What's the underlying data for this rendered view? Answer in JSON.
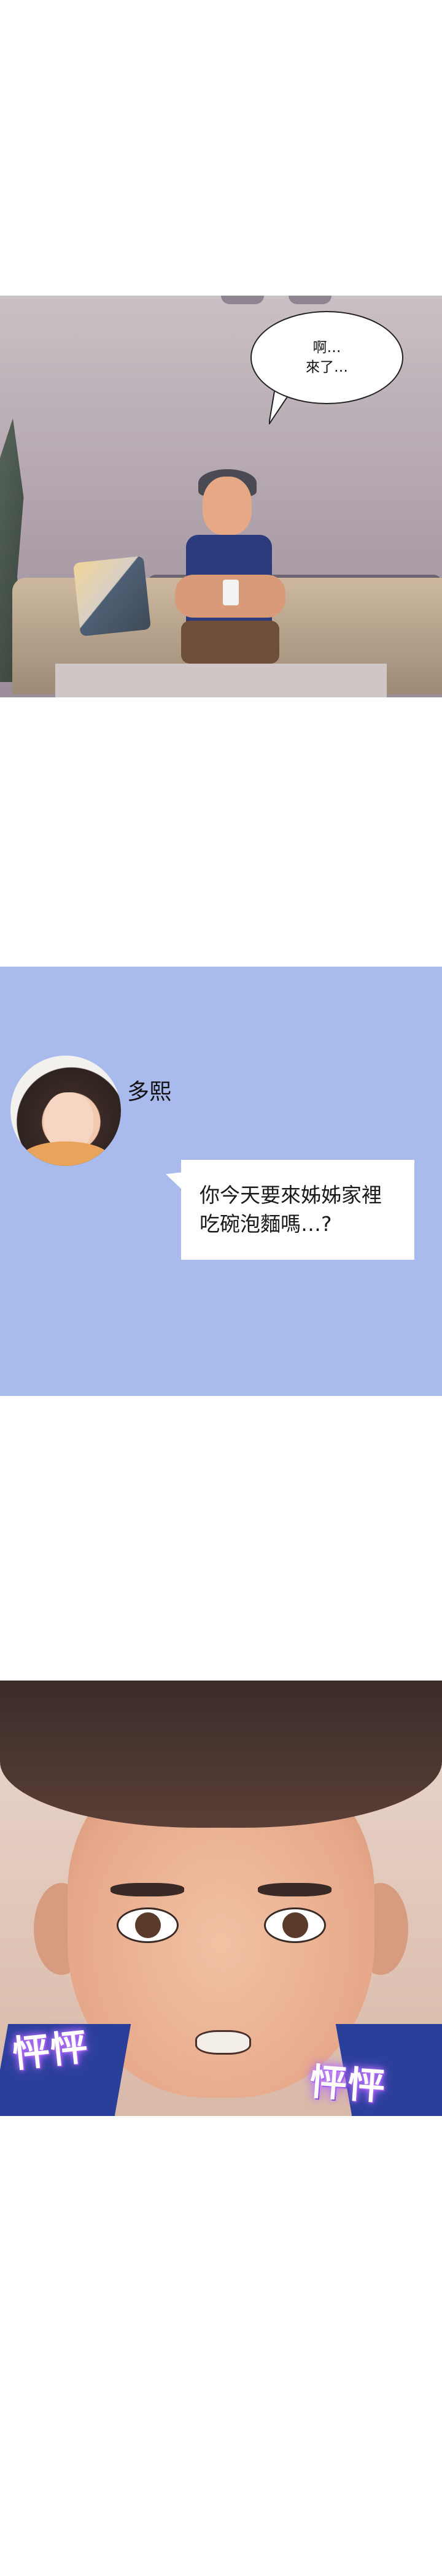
{
  "panel_room": {
    "speech_lines": [
      "啊…",
      "來了…"
    ]
  },
  "panel_chat": {
    "sender_name": "多熙",
    "message_lines": [
      "你今天要來姊姊家裡",
      "吃碗泡麵嗎…?"
    ]
  },
  "panel_face": {
    "sfx_left": "怦怦",
    "sfx_right": "怦怦"
  }
}
